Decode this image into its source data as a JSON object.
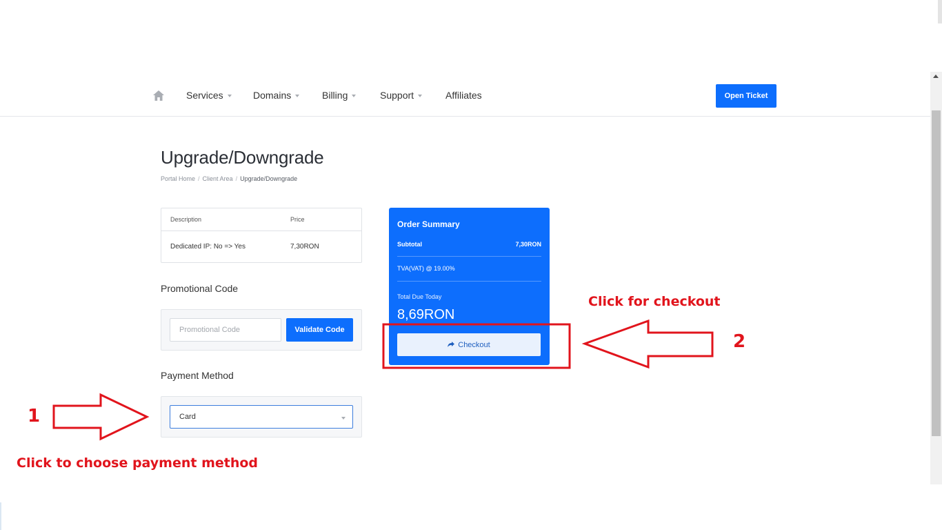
{
  "nav": {
    "items": [
      {
        "label": "Services",
        "dropdown": true
      },
      {
        "label": "Domains",
        "dropdown": true
      },
      {
        "label": "Billing",
        "dropdown": true
      },
      {
        "label": "Support",
        "dropdown": true
      },
      {
        "label": "Affiliates",
        "dropdown": false
      }
    ],
    "open_ticket_label": "Open Ticket",
    "home_icon": "home-icon"
  },
  "page": {
    "title": "Upgrade/Downgrade",
    "breadcrumb": [
      "Portal Home",
      "Client Area",
      "Upgrade/Downgrade"
    ]
  },
  "table": {
    "headers": [
      "Description",
      "Price"
    ],
    "rows": [
      [
        "Dedicated IP: No => Yes",
        "7,30RON"
      ]
    ]
  },
  "promo": {
    "heading": "Promotional Code",
    "placeholder": "Promotional Code",
    "validate_label": "Validate Code"
  },
  "payment": {
    "heading": "Payment Method",
    "selected": "Card"
  },
  "summary": {
    "title": "Order Summary",
    "subtotal_label": "Subtotal",
    "subtotal_value": "7,30RON",
    "tax_label": "TVA(VAT) @ 19.00%",
    "due_label": "Total Due Today",
    "due_value": "8,69RON",
    "checkout_label": "Checkout"
  },
  "annotations": {
    "step1_number": "1",
    "step1_text": "Click to choose payment method",
    "step2_number": "2",
    "step2_text": "Click for checkout",
    "color": "#e1141c"
  },
  "colors": {
    "primary": "#0d6efd"
  }
}
